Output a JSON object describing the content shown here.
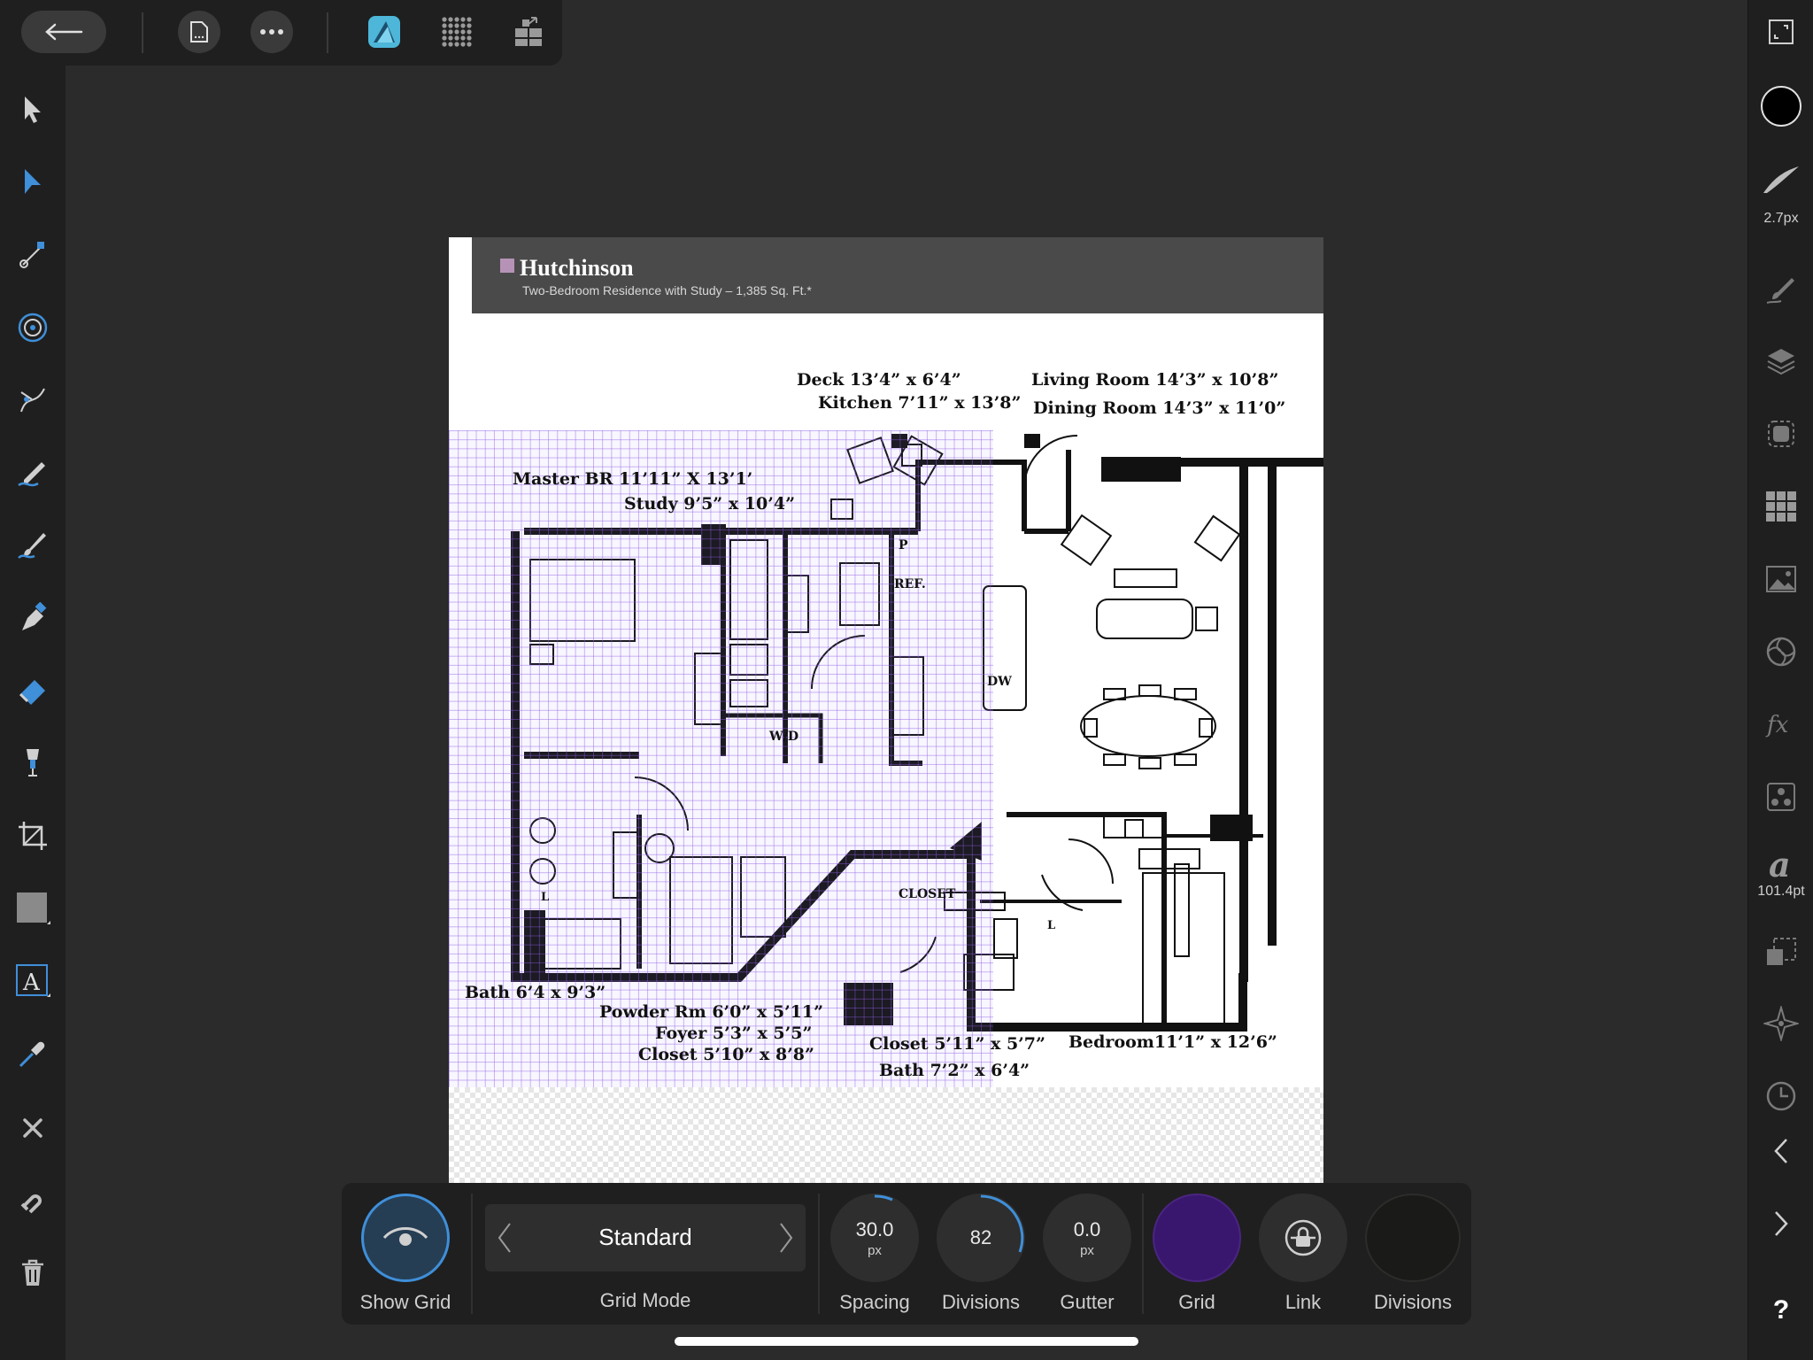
{
  "colors": {
    "accent": "#3f8fd9",
    "grid_color": "#3a176e",
    "divisions_color": "#1a1a18",
    "brush_color": "#000000"
  },
  "topbar": {
    "back_icon": "arrow-left-icon",
    "document_icon": "document-icon",
    "more_icon": "more-icon",
    "persona_icon": "designer-persona-icon",
    "pixel_persona_icon": "pixel-persona-icon",
    "export_persona_icon": "export-persona-icon"
  },
  "left_tools": [
    "move-tool-icon",
    "node-tool-icon",
    "corner-tool-icon",
    "point-transform-icon",
    "pen-tool-icon",
    "pencil-tool-icon",
    "vector-brush-icon",
    "pen-nib-icon",
    "fill-tool-icon",
    "transparency-tool-icon",
    "crop-tool-icon",
    "shape-tool-icon",
    "text-tool-icon",
    "color-picker-icon",
    "close-icon",
    "snapping-icon",
    "trash-icon"
  ],
  "right_studio": {
    "brush_size": "2.7px",
    "font_size": "101.4pt",
    "help": "?"
  },
  "document": {
    "title": "Hutchinson",
    "subtitle": "Two-Bedroom Residence with Study – 1,385 Sq. Ft.*",
    "labels": {
      "deck": "Deck 13’4” x  6’4”",
      "kitchen": "Kitchen 7’11” x 13’8”",
      "living": "Living Room 14’3” x 10’8”",
      "dining": "Dining Room 14’3” x 11’0”",
      "master": "Master BR 11’11” X 13’1’",
      "study": "Study 9’5” x 10’4”",
      "bath1": "Bath 6’4 x 9’3”",
      "powder": "Powder Rm 6’0” x 5’11”",
      "foyer": "Foyer 5’3” x 5’5”",
      "closet1": "Closet 5’10” x 8’8”",
      "closet2": "Closet 5’11” x 5’7”",
      "bath2": "Bath 7’2” x 6’4”",
      "bedroom": "Bedroom11’1” x 12’6”",
      "p": "P",
      "ref": "REF.",
      "dw": "DW",
      "wd": "W/D",
      "closet_tag": "CLOSET",
      "l1": "L",
      "l2": "L"
    }
  },
  "context_toolbar": {
    "show_grid_label": "Show Grid",
    "grid_mode_value": "Standard",
    "grid_mode_label": "Grid Mode",
    "spacing_value": "30.0",
    "spacing_unit": "px",
    "spacing_label": "Spacing",
    "divisions_value": "82",
    "divisions_label": "Divisions",
    "gutter_value": "0.0",
    "gutter_unit": "px",
    "gutter_label": "Gutter",
    "grid_label": "Grid",
    "link_label": "Link",
    "divisions2_label": "Divisions"
  }
}
